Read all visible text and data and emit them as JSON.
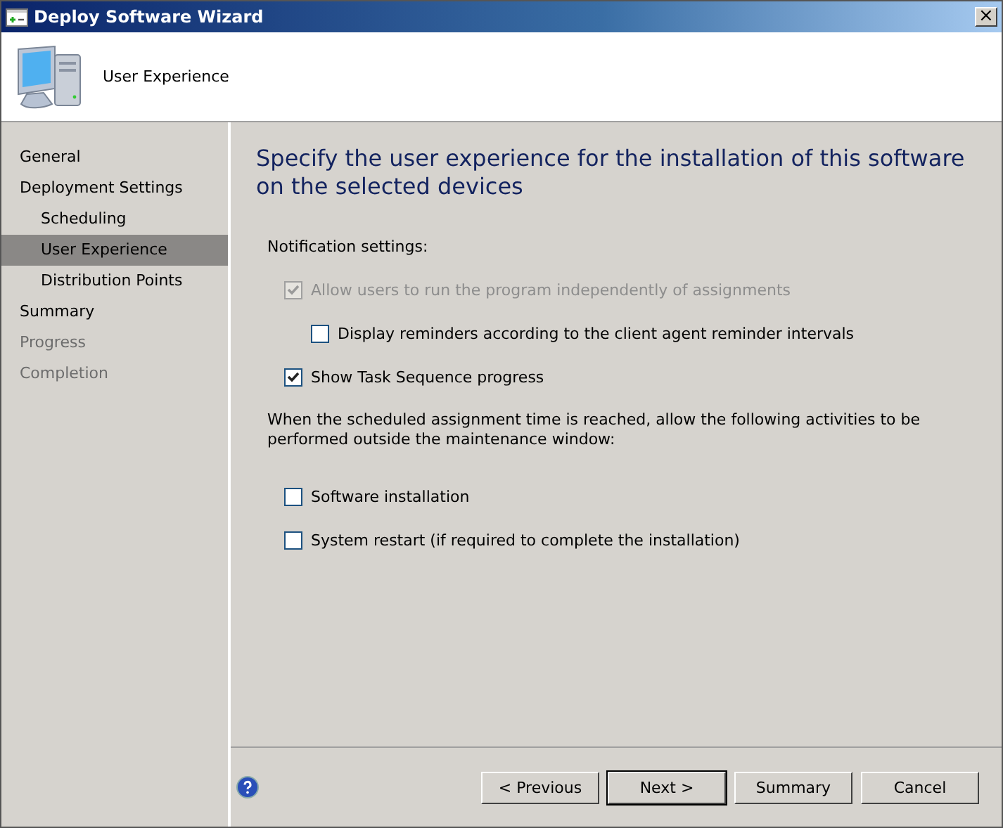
{
  "window": {
    "title": "Deploy Software Wizard",
    "close": "×"
  },
  "header": {
    "title": "User Experience"
  },
  "sidebar": {
    "items": [
      {
        "label": "General",
        "selected": false,
        "disabled": false
      },
      {
        "label": "Deployment Settings",
        "selected": false,
        "disabled": false,
        "children": [
          {
            "label": "Scheduling",
            "selected": false,
            "disabled": false
          },
          {
            "label": "User Experience",
            "selected": true,
            "disabled": false
          },
          {
            "label": "Distribution Points",
            "selected": false,
            "disabled": false
          }
        ]
      },
      {
        "label": "Summary",
        "selected": false,
        "disabled": false
      },
      {
        "label": "Progress",
        "selected": false,
        "disabled": true
      },
      {
        "label": "Completion",
        "selected": false,
        "disabled": true
      }
    ]
  },
  "page": {
    "heading": "Specify the user experience for the installation of this software on the selected devices",
    "notification_label": "Notification settings:",
    "notification_options": [
      {
        "label": "Allow users to run the program independently of assignments",
        "checked": true,
        "disabled": true,
        "children": [
          {
            "label": "Display reminders according to the client agent reminder intervals",
            "checked": false,
            "disabled": false
          }
        ]
      },
      {
        "label": "Show Task Sequence progress",
        "checked": true,
        "disabled": false
      }
    ],
    "maintenance_label": "When the scheduled assignment time is reached, allow the following activities to be performed outside the maintenance window:",
    "maintenance_options": [
      {
        "label": "Software installation",
        "checked": false,
        "disabled": false
      },
      {
        "label": "System restart (if required to complete the installation)",
        "checked": false,
        "disabled": false
      }
    ]
  },
  "footer": {
    "buttons": [
      {
        "label": "< Previous",
        "default": false
      },
      {
        "label": "Next >",
        "default": true
      },
      {
        "label": "Summary",
        "default": false
      },
      {
        "label": "Cancel",
        "default": false
      }
    ]
  }
}
